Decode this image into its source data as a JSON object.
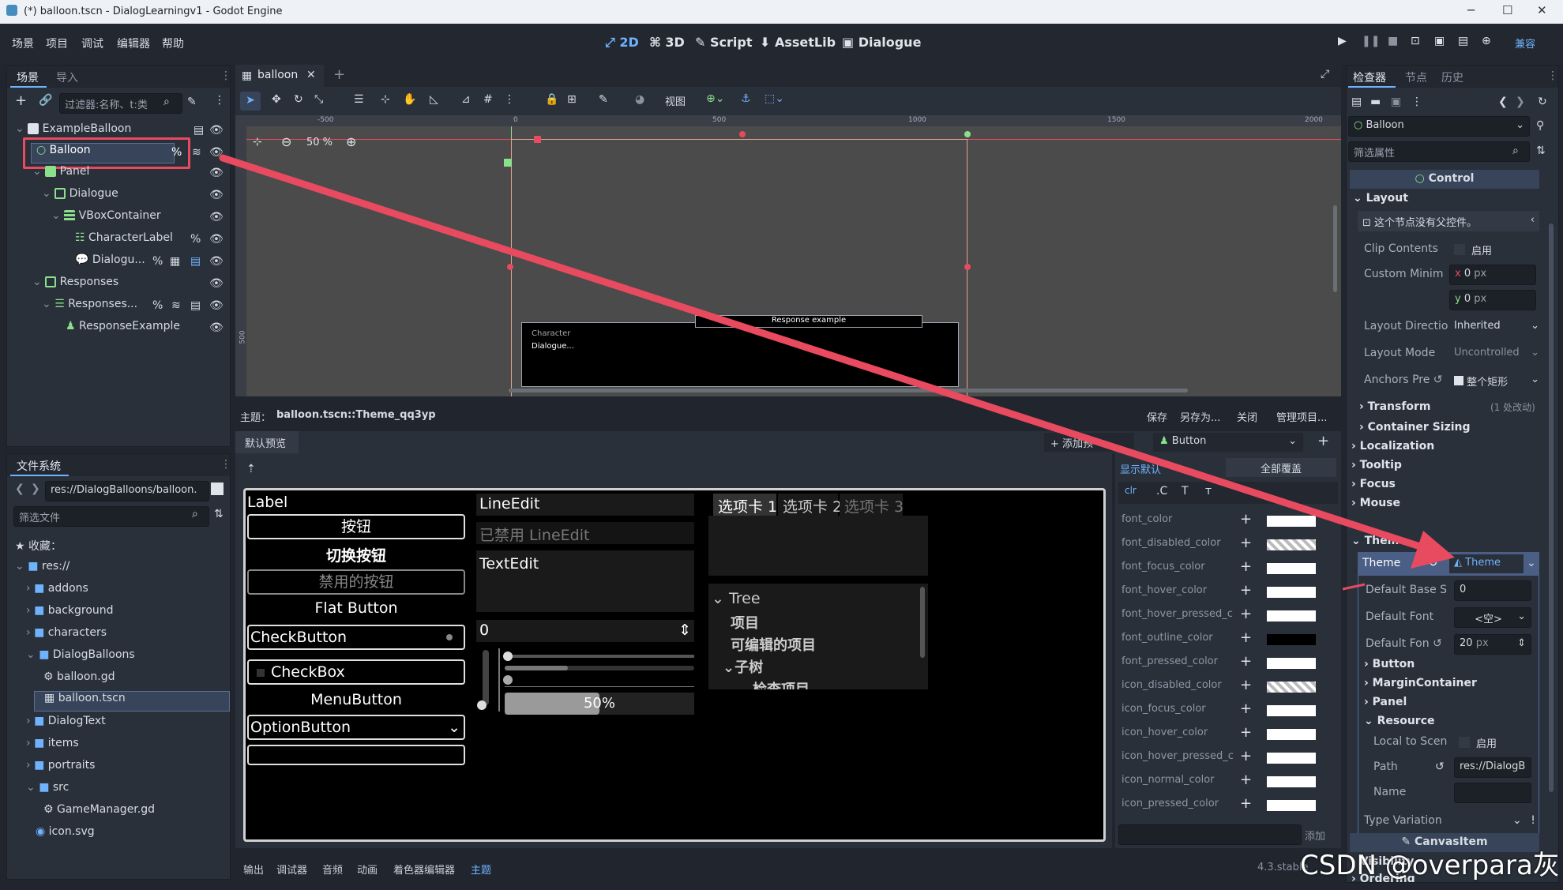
{
  "title": "(*) balloon.tscn - DialogLearningv1 - Godot Engine",
  "menus": [
    "场景",
    "项目",
    "调试",
    "编辑器",
    "帮助"
  ],
  "modes": [
    "2D",
    "3D",
    "Script",
    "AssetLib",
    "Dialogue"
  ],
  "renderer": "兼容",
  "scene_tabs": [
    "场景",
    "导入"
  ],
  "filter_nodes": "过滤器:名称、t:类",
  "scene_tree": [
    {
      "label": "ExampleBalloon"
    },
    {
      "label": "Balloon"
    },
    {
      "label": "Panel"
    },
    {
      "label": "Dialogue"
    },
    {
      "label": "VBoxContainer"
    },
    {
      "label": "CharacterLabel"
    },
    {
      "label": "Dialogu..."
    },
    {
      "label": "Responses"
    },
    {
      "label": "Responses..."
    },
    {
      "label": "ResponseExample"
    }
  ],
  "fs_title": "文件系统",
  "fs_path": "res://DialogBalloons/balloon.",
  "fs_filter": "筛选文件",
  "fs_items": [
    {
      "label": "收藏："
    },
    {
      "label": "res://"
    },
    {
      "label": "addons"
    },
    {
      "label": "background"
    },
    {
      "label": "characters"
    },
    {
      "label": "DialogBalloons"
    },
    {
      "label": "balloon.gd"
    },
    {
      "label": "balloon.tscn"
    },
    {
      "label": "DialogText"
    },
    {
      "label": "items"
    },
    {
      "label": "portraits"
    },
    {
      "label": "src"
    },
    {
      "label": "GameManager.gd"
    },
    {
      "label": "icon.svg"
    }
  ],
  "editor_tab": "balloon",
  "toolbar_view": "视图",
  "zoom": "50 %",
  "ruler": [
    "-500",
    "0",
    "500",
    "1000",
    "1500",
    "2000"
  ],
  "ruler_v": [
    "500"
  ],
  "viewport": {
    "character": "Character",
    "dialogue": "Dialogue...",
    "response": "Response example"
  },
  "theme_bar": {
    "label": "主题：",
    "resource": "balloon.tscn::Theme_qq3yp",
    "save": "保存",
    "save_as": "另存为...",
    "close": "关闭",
    "manage": "管理项目..."
  },
  "preview_tab": "默认预览",
  "add_preview": "添加预",
  "type_select": "Button",
  "preview": {
    "label": "Label",
    "button": "按钮",
    "toggle": "切换按钮",
    "disabled": "禁用的按钮",
    "flat": "Flat Button",
    "checkbutton": "CheckButton",
    "checkbox": "CheckBox",
    "menubutton": "MenuButton",
    "option": "OptionButton",
    "lineedit": "LineEdit",
    "lineedit_disabled": "已禁用 LineEdit",
    "textedit": "TextEdit",
    "spin": "0",
    "progress": "50%",
    "tabs": [
      "选项卡 1",
      "选项卡 2",
      "选项卡 3"
    ],
    "tree": [
      "Tree",
      "项目",
      "可编辑的项目",
      "子树",
      "检查项目"
    ]
  },
  "theme_items": {
    "show_default": "显示默认",
    "override_all": "全部覆盖",
    "add": "添加",
    "rows": [
      "font_color",
      "font_disabled_color",
      "font_focus_color",
      "font_hover_color",
      "font_hover_pressed_c",
      "font_outline_color",
      "font_pressed_color",
      "icon_disabled_color",
      "icon_focus_color",
      "icon_hover_color",
      "icon_hover_pressed_c",
      "icon_normal_color",
      "icon_pressed_color"
    ]
  },
  "bottom_tabs": [
    "输出",
    "调试器",
    "音频",
    "动画",
    "着色器编辑器",
    "主题"
  ],
  "version": "4.3.stable",
  "watermark": "CSDN @overpara灰",
  "inspector": {
    "tabs": [
      "检查器",
      "节点",
      "历史"
    ],
    "node": "Balloon",
    "filter": "筛选属性",
    "class": "Control",
    "layout": "Layout",
    "no_parent": "这个节点没有父控件。",
    "clip": "Clip Contents",
    "enable": "启用",
    "custom_min": "Custom Minim",
    "x": "0",
    "y": "0",
    "px": "px",
    "layout_dir": "Layout Directio",
    "layout_dir_val": "Inherited",
    "layout_mode": "Layout Mode",
    "layout_mode_val": "Uncontrolled",
    "anchors": "Anchors Pre",
    "anchors_val": "整个矩形",
    "transform": "Transform",
    "changes": "(1 处改动)",
    "container_sizing": "Container Sizing",
    "sections": [
      "Localization",
      "Tooltip",
      "Focus",
      "Mouse"
    ],
    "theme_sec": "Theme",
    "theme": "Theme",
    "theme_val": "Theme",
    "base_scale": "Default Base S",
    "base_scale_val": "0",
    "font": "Default Font",
    "font_val": "<空>",
    "font_size": "Default Fon",
    "font_size_val": "20",
    "sub": [
      "Button",
      "MarginContainer",
      "Panel",
      "Resource"
    ],
    "local": "Local to Scen",
    "path": "Path",
    "path_val": "res://DialogB",
    "name": "Name",
    "type_var": "Type Variation",
    "canvas": "CanvasItem",
    "visibility": "Visibility",
    "ordering": "Ordering"
  },
  "colors": {
    "accent": "#6fb3ff",
    "arrow": "#e84a5f",
    "bg": "#21262e"
  }
}
